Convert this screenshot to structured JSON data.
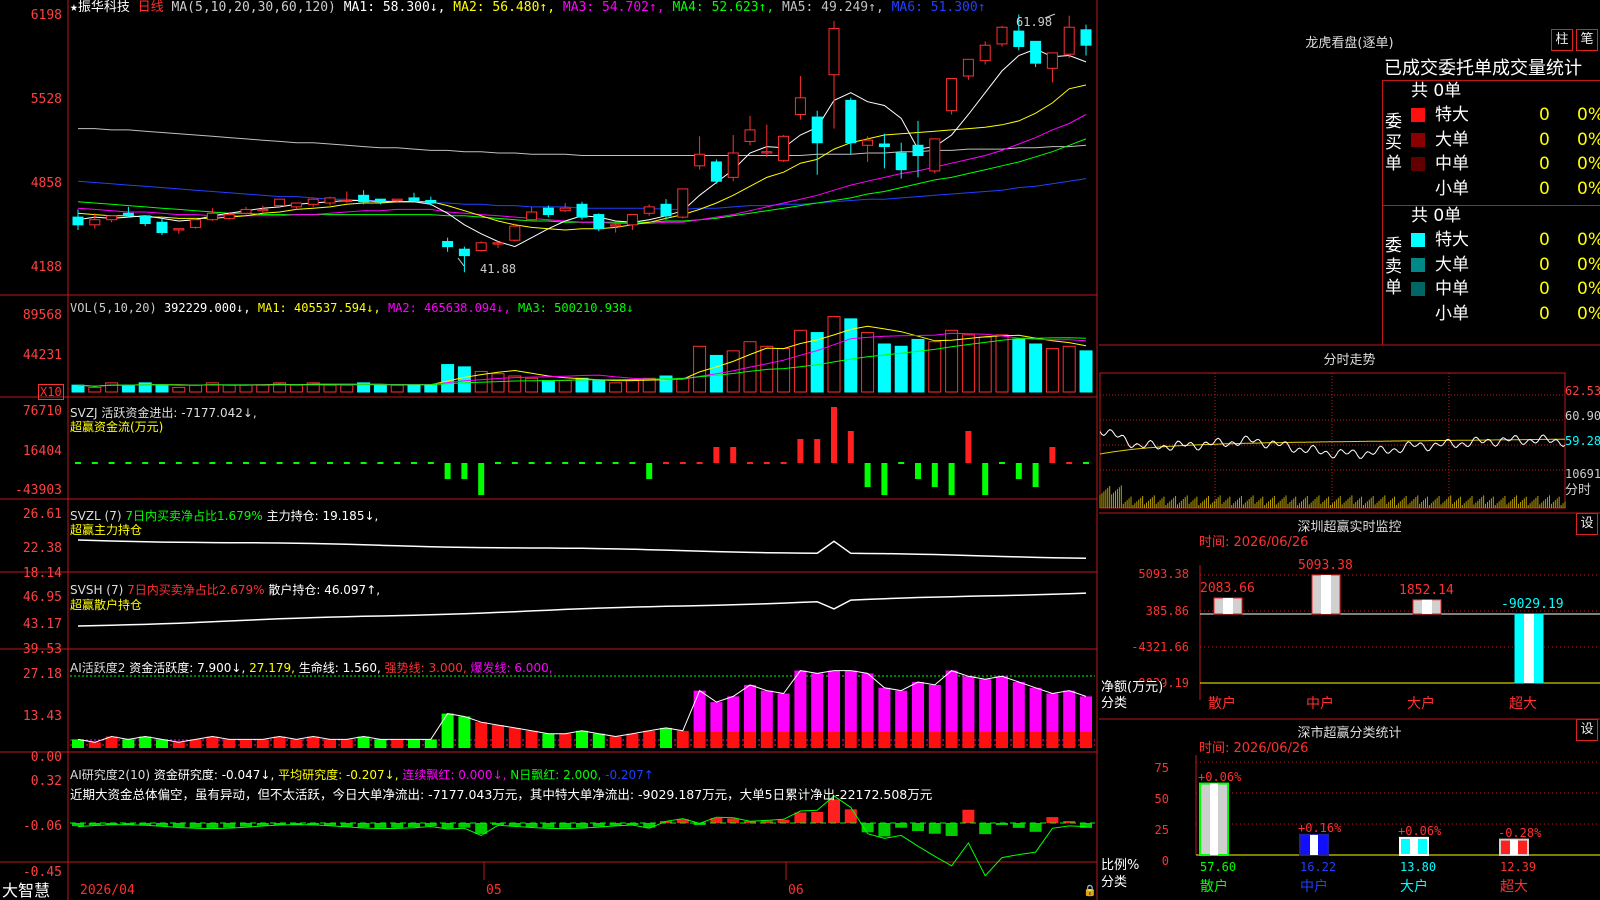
{
  "colors": {
    "up": "#ff3030",
    "down": "#00ffff",
    "bg": "#000000",
    "grid": "#c01818",
    "ma1": "#ffffff",
    "ma2": "#ffff00",
    "ma3": "#ff00ff",
    "ma4": "#00ff00",
    "ma5": "#c0c0c0",
    "ma6": "#2040ff"
  },
  "price_panel": {
    "header_star": "★",
    "stock_name": "振华科技",
    "period": "日线",
    "ma_label": "MA(5,10,20,30,60,120)",
    "ma1": "MA1: 58.300↓,",
    "ma2": "MA2: 56.480↑,",
    "ma3": "MA3: 54.702↑,",
    "ma4": "MA4: 52.623↑,",
    "ma5": "MA5: 49.249↑,",
    "ma6": "MA6: 51.300↑",
    "axis": [
      "6198",
      "5528",
      "4858",
      "4188"
    ],
    "high_note": "61.98",
    "low_note": "41.88",
    "candles": [
      [
        46.2,
        46.8,
        45.6,
        45.2
      ],
      [
        45.6,
        46.5,
        46.0,
        45.3
      ],
      [
        46.0,
        46.3,
        46.3,
        45.8
      ],
      [
        46.5,
        47.0,
        46.3,
        46.2
      ],
      [
        46.3,
        46.3,
        45.7,
        45.5
      ],
      [
        45.8,
        46.1,
        45.0,
        44.8
      ],
      [
        45.2,
        45.3,
        45.3,
        44.9
      ],
      [
        45.4,
        46.1,
        46.0,
        45.3
      ],
      [
        46.0,
        46.9,
        46.5,
        45.9
      ],
      [
        46.1,
        46.6,
        46.4,
        46.0
      ],
      [
        46.5,
        47.0,
        46.8,
        46.4
      ],
      [
        46.7,
        47.1,
        46.8,
        46.5
      ],
      [
        47.1,
        47.5,
        47.6,
        46.9
      ],
      [
        47.0,
        47.3,
        47.3,
        46.8
      ],
      [
        47.2,
        47.6,
        47.6,
        47.0
      ],
      [
        47.3,
        47.8,
        47.7,
        47.1
      ],
      [
        47.5,
        48.2,
        47.5,
        47.3
      ],
      [
        47.9,
        48.3,
        47.4,
        47.2
      ],
      [
        47.6,
        47.6,
        47.4,
        47.2
      ],
      [
        47.5,
        47.6,
        47.6,
        47.3
      ],
      [
        47.7,
        48.1,
        47.5,
        47.4
      ],
      [
        47.5,
        47.8,
        47.3,
        47.1
      ],
      [
        44.3,
        44.6,
        43.9,
        43.5
      ],
      [
        43.7,
        43.9,
        43.2,
        41.9
      ],
      [
        43.6,
        44.3,
        44.2,
        43.5
      ],
      [
        44.1,
        44.3,
        44.2,
        43.8
      ],
      [
        44.4,
        45.7,
        45.5,
        44.3
      ],
      [
        46.0,
        47.0,
        46.6,
        45.9
      ],
      [
        46.9,
        47.1,
        46.4,
        46.2
      ],
      [
        46.7,
        47.3,
        46.9,
        46.6
      ],
      [
        47.2,
        47.4,
        46.2,
        46.0
      ],
      [
        46.4,
        46.5,
        45.3,
        45.1
      ],
      [
        45.5,
        45.8,
        45.6,
        45.0
      ],
      [
        45.6,
        46.4,
        46.4,
        45.2
      ],
      [
        46.5,
        47.2,
        47.0,
        46.3
      ],
      [
        47.2,
        47.6,
        46.3,
        46.0
      ],
      [
        46.2,
        48.2,
        48.4,
        46.1
      ],
      [
        50.2,
        52.5,
        51.1,
        49.9
      ],
      [
        50.5,
        50.7,
        49.0,
        48.8
      ],
      [
        49.3,
        52.6,
        51.2,
        49.0
      ],
      [
        52.1,
        54.1,
        53.0,
        51.8
      ],
      [
        51.2,
        53.4,
        51.3,
        50.9
      ],
      [
        50.6,
        52.6,
        52.5,
        50.5
      ],
      [
        54.2,
        57.2,
        55.5,
        53.8
      ],
      [
        54.0,
        54.5,
        52.0,
        49.5
      ],
      [
        57.3,
        61.5,
        60.9,
        53.1
      ],
      [
        55.3,
        55.5,
        52.0,
        51.1
      ],
      [
        51.8,
        52.5,
        52.2,
        50.5
      ],
      [
        51.9,
        52.7,
        51.7,
        50.0
      ],
      [
        51.2,
        52.0,
        49.9,
        49.2
      ],
      [
        51.8,
        53.7,
        51.0,
        49.3
      ],
      [
        49.8,
        52.3,
        52.3,
        49.6
      ],
      [
        54.5,
        56.6,
        57.0,
        54.2
      ],
      [
        57.2,
        58.4,
        58.5,
        56.9
      ],
      [
        58.4,
        59.9,
        59.6,
        58.1
      ],
      [
        59.7,
        61.1,
        61.0,
        59.5
      ],
      [
        60.7,
        62.0,
        59.5,
        59.2
      ],
      [
        59.9,
        59.9,
        58.2,
        57.9
      ],
      [
        57.8,
        58.8,
        59.0,
        56.7
      ],
      [
        58.9,
        61.9,
        61.0,
        58.6
      ],
      [
        60.8,
        61.2,
        59.6,
        58.8
      ]
    ],
    "ma5_line": [
      46.0,
      46.2,
      46.1,
      46.2,
      46.3,
      46.1,
      45.9,
      46.0,
      46.3,
      46.5,
      46.7,
      46.9,
      47.0,
      47.2,
      47.3,
      47.4,
      47.5,
      47.5,
      47.4,
      47.4,
      47.4,
      47.2,
      46.5,
      45.6,
      44.9,
      44.3,
      43.9,
      44.6,
      45.3,
      45.9,
      46.3,
      46.2,
      45.9,
      45.8,
      46.0,
      46.3,
      46.7,
      47.9,
      48.9,
      49.9,
      51.2,
      51.7,
      51.6,
      52.6,
      53.2,
      55.3,
      55.9,
      55.2,
      54.9,
      53.9,
      51.5,
      51.7,
      52.6,
      54.2,
      55.9,
      57.6,
      58.8,
      59.3,
      58.7,
      58.8,
      58.3
    ],
    "ma10_line": [
      46.5,
      46.4,
      46.3,
      46.3,
      46.2,
      46.2,
      46.1,
      46.1,
      46.1,
      46.2,
      46.3,
      46.5,
      46.6,
      46.8,
      46.9,
      47.0,
      47.2,
      47.3,
      47.3,
      47.4,
      47.4,
      47.4,
      47.1,
      46.7,
      46.3,
      45.9,
      45.6,
      45.4,
      45.3,
      45.2,
      45.3,
      45.3,
      45.4,
      45.6,
      45.8,
      46.1,
      46.4,
      46.8,
      47.3,
      47.9,
      48.6,
      49.3,
      49.7,
      50.4,
      50.7,
      51.5,
      52.0,
      52.3,
      52.6,
      52.7,
      52.8,
      52.9,
      53.0,
      53.1,
      53.2,
      53.4,
      53.7,
      54.3,
      55.1,
      56.2,
      56.5
    ],
    "ma20_line": [
      46.9,
      46.8,
      46.7,
      46.6,
      46.6,
      46.5,
      46.4,
      46.4,
      46.3,
      46.3,
      46.3,
      46.3,
      46.3,
      46.4,
      46.4,
      46.5,
      46.6,
      46.7,
      46.7,
      46.8,
      46.8,
      46.8,
      46.6,
      46.5,
      46.4,
      46.3,
      46.2,
      46.1,
      46.0,
      45.9,
      45.8,
      45.8,
      45.7,
      45.7,
      45.7,
      45.8,
      45.8,
      46.0,
      46.2,
      46.4,
      46.7,
      47.0,
      47.3,
      47.6,
      47.9,
      48.3,
      48.7,
      49.0,
      49.3,
      49.6,
      49.8,
      50.1,
      50.4,
      50.7,
      51.0,
      51.4,
      51.9,
      52.4,
      53.0,
      53.5,
      54.2
    ],
    "ma30_line": [
      47.4,
      47.3,
      47.2,
      47.1,
      47.0,
      46.9,
      46.8,
      46.7,
      46.6,
      46.5,
      46.5,
      46.4,
      46.4,
      46.4,
      46.4,
      46.4,
      46.4,
      46.4,
      46.4,
      46.4,
      46.4,
      46.4,
      46.3,
      46.3,
      46.2,
      46.1,
      46.0,
      45.9,
      45.9,
      45.8,
      45.8,
      45.8,
      45.8,
      45.8,
      45.8,
      45.9,
      45.9,
      46.0,
      46.1,
      46.3,
      46.5,
      46.7,
      46.9,
      47.1,
      47.3,
      47.5,
      47.7,
      48.0,
      48.2,
      48.5,
      48.8,
      49.1,
      49.3,
      49.6,
      49.9,
      50.2,
      50.5,
      50.9,
      51.3,
      51.8,
      52.3
    ],
    "ma60_line": [
      49.0,
      48.9,
      48.8,
      48.7,
      48.6,
      48.5,
      48.4,
      48.3,
      48.2,
      48.1,
      48.0,
      47.9,
      47.8,
      47.8,
      47.7,
      47.6,
      47.6,
      47.5,
      47.5,
      47.4,
      47.4,
      47.3,
      47.3,
      47.2,
      47.2,
      47.1,
      47.1,
      47.0,
      47.0,
      47.0,
      46.9,
      46.9,
      46.9,
      46.9,
      46.9,
      46.8,
      46.8,
      46.9,
      46.9,
      47.0,
      47.1,
      47.1,
      47.2,
      47.2,
      47.3,
      47.4,
      47.5,
      47.6,
      47.6,
      47.7,
      47.8,
      47.9,
      48.0,
      48.1,
      48.2,
      48.3,
      48.5,
      48.6,
      48.8,
      49.0,
      49.2
    ],
    "ma120_line": [
      53.1,
      53.1,
      53.0,
      53.0,
      52.9,
      52.8,
      52.7,
      52.6,
      52.5,
      52.4,
      52.3,
      52.2,
      52.1,
      52.0,
      52.0,
      51.9,
      51.8,
      51.7,
      51.6,
      51.6,
      51.5,
      51.4,
      51.4,
      51.3,
      51.3,
      51.2,
      51.2,
      51.1,
      51.1,
      51.1,
      51.0,
      51.0,
      51.0,
      51.0,
      51.0,
      51.0,
      51.0,
      51.0,
      51.0,
      51.0,
      51.0,
      51.0,
      51.0,
      51.0,
      51.1,
      51.1,
      51.1,
      51.2,
      51.2,
      51.3,
      51.3,
      51.4,
      51.4,
      51.5,
      51.5,
      51.5,
      51.6,
      51.6,
      51.7,
      51.7,
      51.8
    ]
  },
  "vol_panel": {
    "label": "VOL(5,10,20)",
    "value": "392229.000↓,",
    "ma1": "MA1: 405537.594↓,",
    "ma2": "MA2: 465638.094↓,",
    "ma3": "MA3: 500210.938↓",
    "axis": [
      "89568",
      "44231"
    ],
    "unit": "X10",
    "bars": [
      3,
      2,
      4,
      3,
      4,
      3,
      2,
      3,
      4,
      3,
      3,
      3,
      4,
      3,
      4,
      3,
      3,
      4,
      3,
      3,
      3,
      3,
      12,
      11,
      9,
      8,
      7,
      6,
      5,
      5,
      6,
      5,
      4,
      5,
      6,
      7,
      6,
      20,
      16,
      18,
      22,
      20,
      19,
      27,
      26,
      33,
      32,
      26,
      21,
      20,
      23,
      22,
      27,
      25,
      24,
      25,
      23,
      21,
      19,
      20,
      18
    ]
  },
  "svzj_panel": {
    "line1": "SVZJ  活跃资金进出: -7177.042↓,",
    "line2": "超赢资金流(万元)",
    "axis": [
      "76710",
      "16404",
      "-43903"
    ],
    "values": [
      -1,
      -1,
      -1,
      -1,
      -1,
      -1,
      -1,
      -1,
      -1,
      -1,
      -1,
      -1,
      -1,
      -1,
      -1,
      -1,
      -1,
      -1,
      -1,
      -1,
      -1,
      -1,
      -2,
      -2,
      -4,
      -1,
      -1,
      -1,
      -1,
      -1,
      -1,
      -1,
      -1,
      -1,
      -2,
      0,
      1,
      0,
      2,
      2,
      1,
      1,
      1,
      3,
      3,
      7,
      4,
      -3,
      -4,
      -1,
      -2,
      -3,
      -4,
      4,
      -4,
      -1,
      -2,
      -3,
      2,
      1,
      -1
    ]
  },
  "svzl_panel": {
    "line1_a": "SVZL (7)",
    "line1_b": "7日内买卖净占比1.679%",
    "line1_c": "主力持仓: 19.185↓,",
    "line2": "超赢主力持仓",
    "axis": [
      "26.61",
      "22.38",
      "18.14"
    ]
  },
  "svsh_panel": {
    "line1_a": "SVSH (7)",
    "line1_b": "7日内买卖净占比2.679%",
    "line1_c": "散户持仓: 46.097↑,",
    "line2": "超赢散户持仓",
    "axis": [
      "46.95",
      "43.17",
      "39.53"
    ]
  },
  "ai_active_panel": {
    "label": "AI活跃度2",
    "v1": "资金活跃度: 7.900↓,",
    "v2": "27.179,",
    "v3": "生命线: 1.560,",
    "v4": "强势线: 3.000,",
    "v5": "爆发线: 6.000,",
    "axis": [
      "27.18",
      "13.43",
      "0.00"
    ]
  },
  "ai_research_panel": {
    "label": "AI研究度2(10)",
    "v1": "资金研究度: -0.047↓,",
    "v2": "平均研究度: -0.207↓,",
    "v3": "连续飘红: 0.000↓,",
    "v4": "N日飘红: 2.000,",
    "v5": "-0.207↑",
    "desc": "近期大资金总体偏空，虽有异动，但不太活跃，今日大单净流出: -7177.043万元，其中特大单净流出: -9029.187万元，大单5日累计净出-22172.508万元",
    "axis": [
      "0.32",
      "-0.06",
      "-0.45"
    ]
  },
  "footer": {
    "brand": "大智慧",
    "date": "2026/04",
    "month1": "05",
    "month2": "06"
  },
  "longhu": {
    "title": "龙虎看盘(逐单)",
    "btn_zhu": "柱",
    "btn_bi": "笔",
    "header": "已成交委托单成交量统计",
    "buy_label": "委买单",
    "sell_label": "委卖单",
    "buy_total": "共 0单",
    "sell_total": "共 0单",
    "buy_rows": [
      {
        "name": "特大",
        "count": "0",
        "pct": "0%",
        "color": "#ff1010"
      },
      {
        "name": "大单",
        "count": "0",
        "pct": "0%",
        "color": "#8a0000"
      },
      {
        "name": "中单",
        "count": "0",
        "pct": "0%",
        "color": "#600000"
      },
      {
        "name": "小单",
        "count": "0",
        "pct": "0%",
        "color": ""
      }
    ],
    "sell_rows": [
      {
        "name": "特大",
        "count": "0",
        "pct": "0%",
        "color": "#00ffff"
      },
      {
        "name": "大单",
        "count": "0",
        "pct": "0%",
        "color": "#008888"
      },
      {
        "name": "中单",
        "count": "0",
        "pct": "0%",
        "color": "#006666"
      },
      {
        "name": "小单",
        "count": "0",
        "pct": "0%",
        "color": ""
      }
    ]
  },
  "intraday": {
    "title": "分时走势",
    "axis": [
      "62.53",
      "60.90",
      "59.28",
      "10691"
    ],
    "axis_time": "分时"
  },
  "monitor": {
    "title": "深圳超赢实时监控",
    "btn": "设",
    "time": "时间: 2026/06/26",
    "axis": [
      "5093.38",
      "385.86",
      "-4321.66",
      "-9029.19"
    ],
    "ylabel": "净额(万元)",
    "xlabel": "分类",
    "categories": [
      "散户",
      "中户",
      "大户",
      "超大"
    ],
    "values": [
      2083.66,
      5093.38,
      1852.14,
      -9029.19
    ],
    "value_labels": [
      "2083.66",
      "5093.38",
      "1852.14",
      "-9029.19"
    ]
  },
  "classify": {
    "title": "深市超赢分类统计",
    "btn": "设",
    "time": "时间: 2026/06/26",
    "axis": [
      "75",
      "50",
      "25",
      "0"
    ],
    "ylabel": "比例%",
    "xlabel": "分类",
    "categories": [
      "散户",
      "中户",
      "大户",
      "超大"
    ],
    "values": [
      57.6,
      16.22,
      13.8,
      12.39
    ],
    "value_labels": [
      "57.60",
      "16.22",
      "13.80",
      "12.39"
    ],
    "changes": [
      "+0.06%",
      "+0.16%",
      "+0.06%",
      "-0.28%"
    ]
  }
}
